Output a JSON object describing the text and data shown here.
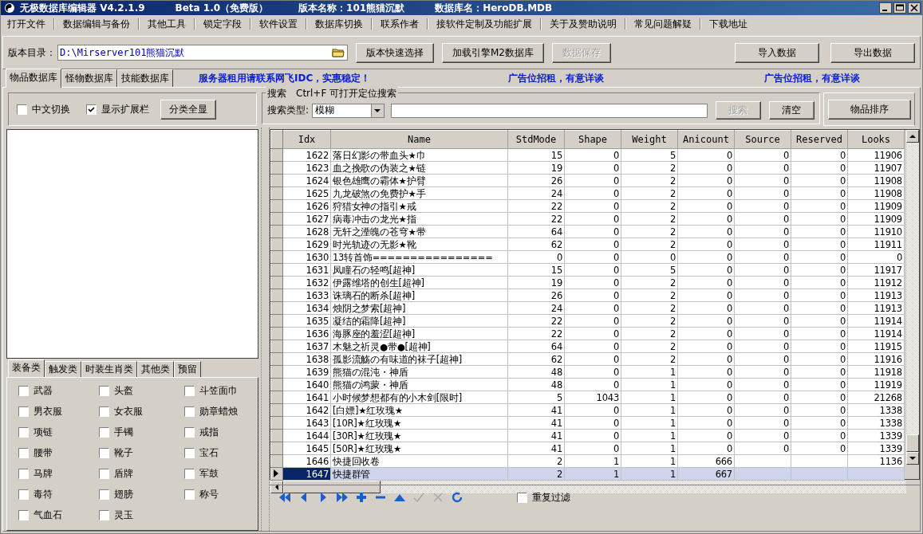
{
  "window": {
    "title_segments": [
      "无极数据库编辑器 V4.2.1.9",
      "Beta 1.0（免费版）",
      "版本名称：101熊猫沉默",
      "数据库名：HeroDB.MDB"
    ]
  },
  "menu": [
    "打开文件",
    "数据编辑与备份",
    "其他工具",
    "锁定字段",
    "软件设置",
    "数据库切换",
    "联系作者",
    "接软件定制及功能扩展",
    "关于及赞助说明",
    "常见问题解疑",
    "下载地址"
  ],
  "toolbar": {
    "path_label": "版本目录：",
    "path_value": "D:\\Mirserver101熊猫沉默",
    "buttons": [
      {
        "label": "版本快速选择",
        "disabled": false
      },
      {
        "label": "加载引擎M2数据库",
        "disabled": false
      },
      {
        "label": "数据保存",
        "disabled": true
      }
    ],
    "right_buttons": [
      {
        "label": "导入数据",
        "disabled": false
      },
      {
        "label": "导出数据",
        "disabled": false
      }
    ]
  },
  "tabs": [
    {
      "label": "物品数据库",
      "selected": true
    },
    {
      "label": "怪物数据库",
      "selected": false
    },
    {
      "label": "技能数据库",
      "selected": false
    }
  ],
  "notices": [
    "服务器租用请联系网飞IDC，实惠稳定！",
    "广告位招租，有意详谈",
    "广告位招租，有意详谈"
  ],
  "options": {
    "checkboxes": [
      {
        "label": "中文切换",
        "checked": false
      },
      {
        "label": "显示扩展栏",
        "checked": true
      }
    ],
    "button": "分类全显"
  },
  "search": {
    "title": "搜索",
    "hint": "Ctrl+F 可打开定位搜索",
    "type_label": "搜索类型:",
    "type_value": "模糊",
    "buttons": [
      {
        "label": "搜索",
        "disabled": true
      },
      {
        "label": "清空",
        "disabled": false
      }
    ],
    "sort_button": "物品排序"
  },
  "grid": {
    "columns": [
      "Idx",
      "Name",
      "StdMode",
      "Shape",
      "Weight",
      "Anicount",
      "Source",
      "Reserved",
      "Looks"
    ],
    "rows": [
      {
        "selected": false,
        "cells": [
          "1622",
          "落日幻影の带血头★巾",
          "15",
          "0",
          "5",
          "0",
          "0",
          "0",
          "11906"
        ]
      },
      {
        "selected": false,
        "cells": [
          "1623",
          "血之挽歌の伪装之★链",
          "19",
          "0",
          "2",
          "0",
          "0",
          "0",
          "11907"
        ]
      },
      {
        "selected": false,
        "cells": [
          "1624",
          "银色雄鹰の霸体★护臂",
          "26",
          "0",
          "2",
          "0",
          "0",
          "0",
          "11908"
        ]
      },
      {
        "selected": false,
        "cells": [
          "1625",
          "九龙破煞の免费护★手",
          "24",
          "0",
          "2",
          "0",
          "0",
          "0",
          "11908"
        ]
      },
      {
        "selected": false,
        "cells": [
          "1626",
          "狩猎女神の指引★戒",
          "22",
          "0",
          "2",
          "0",
          "0",
          "0",
          "11909"
        ]
      },
      {
        "selected": false,
        "cells": [
          "1627",
          "病毒冲击の龙光★指",
          "22",
          "0",
          "2",
          "0",
          "0",
          "0",
          "11909"
        ]
      },
      {
        "selected": false,
        "cells": [
          "1628",
          "无轩之湮魄の苍穹★带",
          "64",
          "0",
          "2",
          "0",
          "0",
          "0",
          "11910"
        ]
      },
      {
        "selected": false,
        "cells": [
          "1629",
          "时光轨迹の无影★靴",
          "62",
          "0",
          "2",
          "0",
          "0",
          "0",
          "11911"
        ]
      },
      {
        "selected": false,
        "cells": [
          "1630",
          "13转首饰================",
          "0",
          "0",
          "0",
          "0",
          "0",
          "0",
          "0"
        ]
      },
      {
        "selected": false,
        "cells": [
          "1631",
          "凤瞳石の轻鸣[超神]",
          "15",
          "0",
          "5",
          "0",
          "0",
          "0",
          "11917"
        ]
      },
      {
        "selected": false,
        "cells": [
          "1632",
          "伊露维塔的创生[超神]",
          "19",
          "0",
          "2",
          "0",
          "0",
          "0",
          "11912"
        ]
      },
      {
        "selected": false,
        "cells": [
          "1633",
          "诛璃石的断杀[超神]",
          "26",
          "0",
          "2",
          "0",
          "0",
          "0",
          "11913"
        ]
      },
      {
        "selected": false,
        "cells": [
          "1634",
          "烛阴之梦索[超神]",
          "24",
          "0",
          "2",
          "0",
          "0",
          "0",
          "11913"
        ]
      },
      {
        "selected": false,
        "cells": [
          "1635",
          "凝结的霜降[超神]",
          "22",
          "0",
          "2",
          "0",
          "0",
          "0",
          "11914"
        ]
      },
      {
        "selected": false,
        "cells": [
          "1636",
          "海豚座的羞涩[超神]",
          "22",
          "0",
          "2",
          "0",
          "0",
          "0",
          "11914"
        ]
      },
      {
        "selected": false,
        "cells": [
          "1637",
          "木魅之祈灵●带●[超神]",
          "64",
          "0",
          "2",
          "0",
          "0",
          "0",
          "11915"
        ]
      },
      {
        "selected": false,
        "cells": [
          "1638",
          "孤影流觞の有味道的袜子[超神]",
          "62",
          "0",
          "2",
          "0",
          "0",
          "0",
          "11916"
        ]
      },
      {
        "selected": false,
        "cells": [
          "1639",
          "熊猫の混沌・神盾",
          "48",
          "0",
          "1",
          "0",
          "0",
          "0",
          "11918"
        ]
      },
      {
        "selected": false,
        "cells": [
          "1640",
          "熊猫の鸿蒙・神盾",
          "48",
          "0",
          "1",
          "0",
          "0",
          "0",
          "11919"
        ]
      },
      {
        "selected": false,
        "cells": [
          "1641",
          "小时候梦想都有的小木剑[限时]",
          "5",
          "1043",
          "1",
          "0",
          "0",
          "0",
          "21268"
        ]
      },
      {
        "selected": false,
        "cells": [
          "1642",
          "[白嫖]★红玫瑰★",
          "41",
          "0",
          "1",
          "0",
          "0",
          "0",
          "1338"
        ]
      },
      {
        "selected": false,
        "cells": [
          "1643",
          "[10R]★红玫瑰★",
          "41",
          "0",
          "1",
          "0",
          "0",
          "0",
          "1338"
        ]
      },
      {
        "selected": false,
        "cells": [
          "1644",
          "[30R]★红玫瑰★",
          "41",
          "0",
          "1",
          "0",
          "0",
          "0",
          "1339"
        ]
      },
      {
        "selected": false,
        "cells": [
          "1645",
          "[50R]★红玫瑰★",
          "41",
          "0",
          "1",
          "0",
          "0",
          "0",
          "1339"
        ]
      },
      {
        "selected": false,
        "cells": [
          "1646",
          "快捷回收卷",
          "2",
          "1",
          "1",
          "666",
          null,
          null,
          "1136"
        ]
      },
      {
        "selected": true,
        "cells": [
          "1647",
          "快捷群管",
          "2",
          "1",
          "1",
          "667",
          null,
          null,
          null
        ]
      }
    ]
  },
  "category_tabs": [
    {
      "label": "装备类",
      "selected": true
    },
    {
      "label": "触发类",
      "selected": false
    },
    {
      "label": "时装生肖类",
      "selected": false
    },
    {
      "label": "其他类",
      "selected": false
    },
    {
      "label": "预留",
      "selected": false
    }
  ],
  "categories": [
    {
      "label": "武器",
      "checked": false
    },
    {
      "label": "头盔",
      "checked": false
    },
    {
      "label": "斗笠面巾",
      "checked": false
    },
    {
      "label": "男衣服",
      "checked": false
    },
    {
      "label": "女衣服",
      "checked": false
    },
    {
      "label": "勋章蜡烛",
      "checked": false
    },
    {
      "label": "项链",
      "checked": false
    },
    {
      "label": "手镯",
      "checked": false
    },
    {
      "label": "戒指",
      "checked": false
    },
    {
      "label": "腰带",
      "checked": false
    },
    {
      "label": "靴子",
      "checked": false
    },
    {
      "label": "宝石",
      "checked": false
    },
    {
      "label": "马牌",
      "checked": false
    },
    {
      "label": "盾牌",
      "checked": false
    },
    {
      "label": "军鼓",
      "checked": false
    },
    {
      "label": "毒符",
      "checked": false
    },
    {
      "label": "翅膀",
      "checked": false
    },
    {
      "label": "称号",
      "checked": false
    },
    {
      "label": "气血石",
      "checked": false
    },
    {
      "label": "灵玉",
      "checked": false
    }
  ],
  "navigator": {
    "buttons": [
      {
        "kind": "first",
        "disabled": false
      },
      {
        "kind": "prior",
        "disabled": false
      },
      {
        "kind": "next",
        "disabled": false
      },
      {
        "kind": "last",
        "disabled": false
      },
      {
        "kind": "insert",
        "disabled": false
      },
      {
        "kind": "delete",
        "disabled": false
      },
      {
        "kind": "edit",
        "disabled": false
      },
      {
        "kind": "post",
        "disabled": true
      },
      {
        "kind": "cancel",
        "disabled": true
      },
      {
        "kind": "refresh",
        "disabled": false
      }
    ],
    "filter": {
      "label": "重复过滤",
      "checked": false
    }
  }
}
